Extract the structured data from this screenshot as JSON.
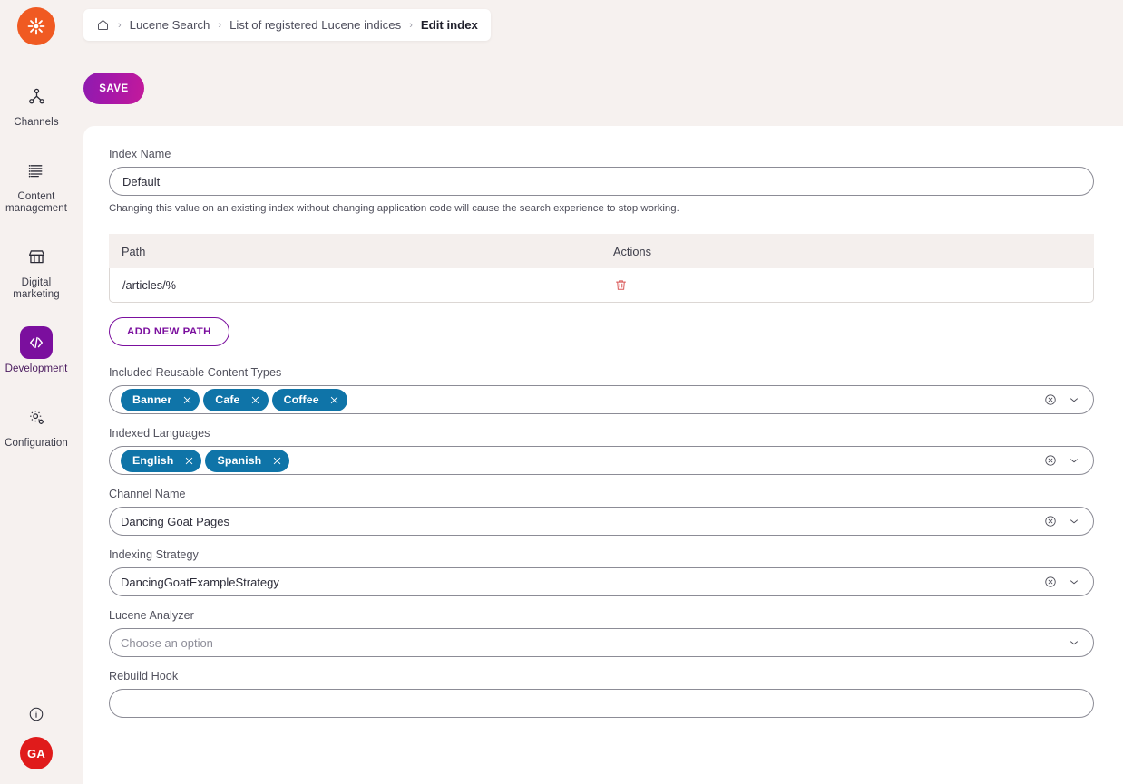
{
  "app": {
    "logo_icon": "kentico-starburst-logo",
    "logo_color": "#f05a22",
    "accent_purple": "#7b0f9e",
    "chip_color": "#0f74a8",
    "avatar_color": "#e01b1b",
    "background": "#f6f1ef"
  },
  "sidebar": {
    "items": [
      {
        "label": "Channels",
        "icon": "channels-icon",
        "active": false
      },
      {
        "label": "Content management",
        "icon": "content-management-icon",
        "active": false
      },
      {
        "label": "Digital marketing",
        "icon": "digital-marketing-icon",
        "active": false
      },
      {
        "label": "Development",
        "icon": "code-icon",
        "active": true
      },
      {
        "label": "Configuration",
        "icon": "gear-icon",
        "active": false
      }
    ],
    "info_icon": "info-circle-icon",
    "avatar_initials": "GA"
  },
  "breadcrumb": {
    "home_icon": "home-icon",
    "separator": "›",
    "items": [
      {
        "label": "Lucene Search",
        "current": false
      },
      {
        "label": "List of registered Lucene indices",
        "current": false
      },
      {
        "label": "Edit index",
        "current": true
      }
    ]
  },
  "toolbar": {
    "save_label": "SAVE"
  },
  "form": {
    "index_name": {
      "label": "Index Name",
      "value": "Default",
      "hint": "Changing this value on an existing index without changing application code will cause the search experience to stop working."
    },
    "paths_table": {
      "columns": [
        "Path",
        "Actions"
      ],
      "rows": [
        {
          "path": "/articles/%",
          "delete_icon": "trash-icon"
        }
      ],
      "add_button_label": "ADD NEW PATH"
    },
    "reusable_content_types": {
      "label": "Included Reusable Content Types",
      "chips": [
        "Banner",
        "Cafe",
        "Coffee"
      ],
      "clear_icon": "circle-x-icon",
      "dropdown_icon": "chevron-down-icon"
    },
    "indexed_languages": {
      "label": "Indexed Languages",
      "chips": [
        "English",
        "Spanish"
      ],
      "clear_icon": "circle-x-icon",
      "dropdown_icon": "chevron-down-icon"
    },
    "channel_name": {
      "label": "Channel Name",
      "value": "Dancing Goat Pages",
      "clear_icon": "circle-x-icon",
      "dropdown_icon": "chevron-down-icon"
    },
    "indexing_strategy": {
      "label": "Indexing Strategy",
      "value": "DancingGoatExampleStrategy",
      "clear_icon": "circle-x-icon",
      "dropdown_icon": "chevron-down-icon"
    },
    "lucene_analyzer": {
      "label": "Lucene Analyzer",
      "placeholder": "Choose an option",
      "value": "",
      "dropdown_icon": "chevron-down-icon"
    },
    "rebuild_hook": {
      "label": "Rebuild Hook",
      "value": "",
      "placeholder": ""
    }
  }
}
